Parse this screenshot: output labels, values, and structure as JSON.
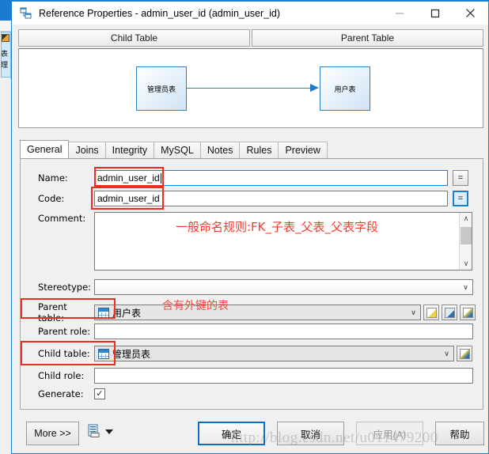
{
  "window": {
    "title": "Reference Properties - admin_user_id (admin_user_id)",
    "icon": "reference-icon",
    "minimize_label": "—",
    "maximize_label": "□",
    "close_label": "✕",
    "accent_color": "#1a7fd4"
  },
  "preview": {
    "child_header": "Child Table",
    "parent_header": "Parent Table",
    "child_entity": "管理员表",
    "parent_entity": "用户表",
    "entity_border_color": "#2f7fc4",
    "relation_arrow_color": "#1f78c8"
  },
  "tabs": [
    {
      "label": "General",
      "active": true
    },
    {
      "label": "Joins",
      "active": false
    },
    {
      "label": "Integrity",
      "active": false
    },
    {
      "label": "MySQL",
      "active": false
    },
    {
      "label": "Notes",
      "active": false
    },
    {
      "label": "Rules",
      "active": false
    },
    {
      "label": "Preview",
      "active": false
    }
  ],
  "general": {
    "name_label": "Name:",
    "name_value": "admin_user_id",
    "name_equals_button": "=",
    "code_label": "Code:",
    "code_value": "admin_user_id",
    "code_equals_button": "=",
    "comment_label": "Comment:",
    "comment_value": "",
    "stereotype_label": "Stereotype:",
    "stereotype_value": "",
    "parent_table_label": "Parent table:",
    "parent_table_value": "用户表",
    "parent_role_label": "Parent role:",
    "parent_role_value": "",
    "child_table_label": "Child table:",
    "child_table_value": "管理员表",
    "child_role_label": "Child role:",
    "child_role_value": "",
    "generate_label": "Generate:",
    "generate_checked": "✓",
    "dropdown_arrow": "∨",
    "scroll_up_arrow": "∧",
    "scroll_down_arrow": "∨",
    "parent_tool_buttons": [
      {
        "name": "create-object-button"
      },
      {
        "name": "browse-object-button"
      },
      {
        "name": "object-properties-button"
      }
    ],
    "child_tool_buttons": [
      {
        "name": "object-properties-button"
      }
    ]
  },
  "annotations": {
    "color": "#f4493c",
    "comment_note": "一般命名规则:FK_子表_父表_父表字段",
    "parent_table_note": "含有外键的表"
  },
  "footer": {
    "more_label": "More >>",
    "report_icon": "report-icon",
    "ok_label": "确定",
    "cancel_label": "取消",
    "apply_label": "应用(A)",
    "help_label": "帮助"
  },
  "watermark": {
    "text": "http://blog.csdn.net/u011479200"
  }
}
